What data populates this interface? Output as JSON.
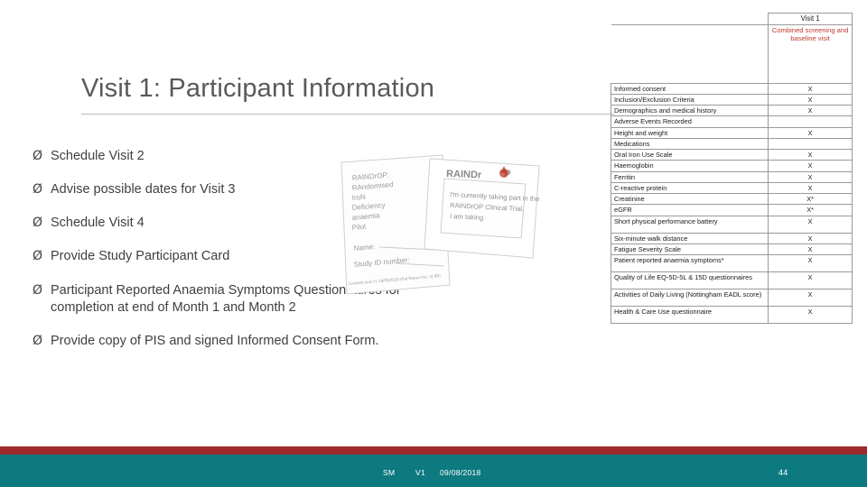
{
  "slide": {
    "title": "Visit 1: Participant Information",
    "bullets": [
      {
        "marker": "Ø",
        "text": "Schedule Visit 2"
      },
      {
        "marker": "Ø",
        "text": "Advise possible dates for Visit 3"
      },
      {
        "marker": "Ø",
        "text": "Schedule Visit 4"
      },
      {
        "marker": "Ø",
        "text": "Provide Study Participant Card"
      },
      {
        "marker": "Ø",
        "text": "Participant Reported Anaemia Symptoms Questionnaires for completion at end of Month 1 and Month 2"
      },
      {
        "marker": "Ø",
        "text": "Provide copy of PIS and signed Informed Consent Form."
      }
    ]
  },
  "photo": {
    "label": "consent-form-photograph",
    "lines": [
      "RAINDrOP:",
      "RAndomised",
      "IroN",
      "Deficiency",
      "anaemia",
      "Pilot",
      "Name:",
      "Study ID number:",
      "Consent and V1 16/05/2018 (Pat Report No. 2) IRC"
    ],
    "card_lines": [
      "I'm currently taking part in the",
      "RAINDrOP Clinical Trial.",
      "I am taking"
    ],
    "card_logo": "RAINDrOP"
  },
  "table": {
    "columns": [
      "",
      "Visit 1"
    ],
    "header_sub": "Combined screening and baseline visit",
    "rows": [
      {
        "label": "Informed consent",
        "mark": "X"
      },
      {
        "label": "Inclusion/Exclusion Criteria",
        "mark": "X"
      },
      {
        "label": "Demographics and medical history",
        "mark": "X"
      },
      {
        "label": "Adverse Events Recorded",
        "mark": ""
      },
      {
        "label": "Height and weight",
        "mark": "X"
      },
      {
        "label": "Medications",
        "mark": ""
      },
      {
        "label": "Oral Iron Use Scale",
        "mark": "X"
      },
      {
        "label": "Haemoglobin",
        "mark": "X"
      },
      {
        "label": "Ferritin",
        "mark": "X"
      },
      {
        "label": "C-reactive protein",
        "mark": "X"
      },
      {
        "label": "Creatinine",
        "mark": "X*"
      },
      {
        "label": "eGFR",
        "mark": "X*"
      },
      {
        "label": "Short physical performance battery",
        "mark": "X"
      },
      {
        "label": "Six-minute walk distance",
        "mark": "X"
      },
      {
        "label": "Fatigue Severity Scale",
        "mark": "X"
      },
      {
        "label": "Patient reported anaemia symptoms*",
        "mark": "X"
      },
      {
        "label": "Quality of Life EQ-5D-5L & 15D questionnaires",
        "mark": "X"
      },
      {
        "label": "Activities of Daily Living (Nottingham EADL score)",
        "mark": "X"
      },
      {
        "label": "Health & Care Use questionnaire",
        "mark": "X"
      }
    ]
  },
  "footer": {
    "initials": "SM",
    "version": "V1",
    "date": "09/08/2018",
    "page": "44"
  },
  "colors": {
    "title": "#595959",
    "band_red": "#9e2b2b",
    "band_teal": "#0d7a80",
    "header_accent": "#c0392b"
  }
}
